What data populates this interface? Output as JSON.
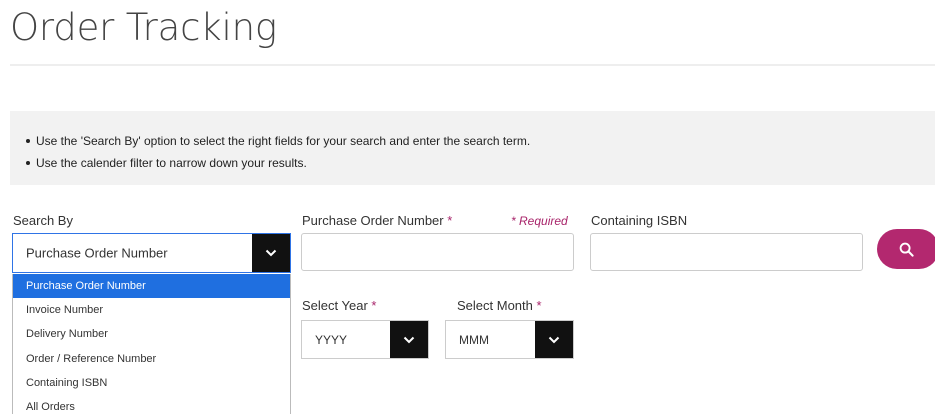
{
  "page": {
    "title": "Order Tracking"
  },
  "instructions": [
    "Use the 'Search By' option to select the right fields for your search and enter the search term.",
    "Use the calender filter to narrow down your results."
  ],
  "search_by": {
    "label": "Search By",
    "selected": "Purchase Order Number",
    "options": [
      "Purchase Order Number",
      "Invoice Number",
      "Delivery Number",
      "Order / Reference Number",
      "Containing ISBN",
      "All Orders"
    ]
  },
  "purchase_order": {
    "label": "Purchase Order Number",
    "required_star": "*",
    "required_note": "* Required",
    "value": "",
    "placeholder": ""
  },
  "containing_isbn": {
    "label": "Containing ISBN",
    "value": "",
    "placeholder": ""
  },
  "select_year": {
    "label": "Select Year",
    "required_star": "*",
    "selected": "YYYY"
  },
  "select_month": {
    "label": "Select Month",
    "required_star": "*",
    "selected": "MMM"
  },
  "search_button": {
    "icon": "search-icon"
  },
  "colors": {
    "accent": "#b3286f",
    "required": "#a8246a",
    "selected_option": "#1f6fe0",
    "arrow_box": "#111111",
    "info_bg": "#f2f2f2"
  }
}
